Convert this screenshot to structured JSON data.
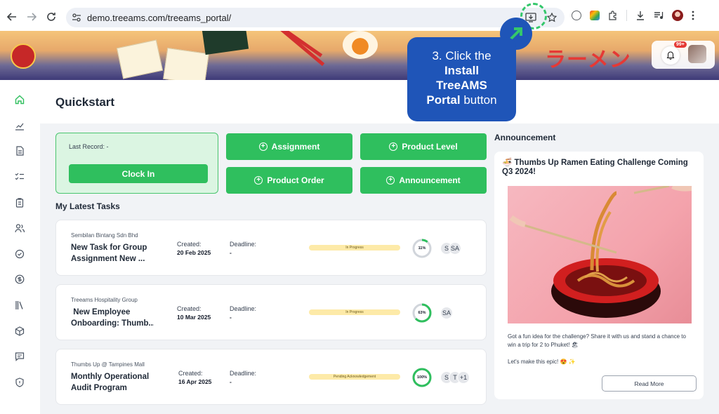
{
  "browser": {
    "url": "demo.treeams.com/treeams_portal/"
  },
  "banner": {
    "ramen_text": "ラーメン",
    "notification_count": "99+"
  },
  "page": {
    "title": "Quickstart"
  },
  "record": {
    "label": "Last Record: -",
    "clock_in_label": "Clock In"
  },
  "quick_actions": [
    {
      "label": "Assignment"
    },
    {
      "label": "Product Level"
    },
    {
      "label": "Product Order"
    },
    {
      "label": "Announcement"
    }
  ],
  "tasks_section": {
    "title": "My Latest Tasks",
    "created_label": "Created:",
    "deadline_label": "Deadline:"
  },
  "tasks": [
    {
      "company": "Sembilan Bintang Sdn Bhd",
      "title": "New Task for Group\nAssignment New ...",
      "created": "20 Feb 2025",
      "deadline": "-",
      "status": "In Progress",
      "progress_text": "11%",
      "progress": 0.11,
      "assignees": [
        "S",
        "SA"
      ]
    },
    {
      "company": "Treeams Hospitality Group",
      "title": " New Employee\nOnboarding: Thumb...",
      "created": "10 Mar 2025",
      "deadline": "-",
      "status": "In Progress",
      "progress_text": "63%",
      "progress": 0.63,
      "assignees": [
        "SA"
      ]
    },
    {
      "company": "Thumbs Up @ Tampines Mall",
      "title": "Monthly Operational\nAudit Program",
      "created": "16 Apr 2025",
      "deadline": "-",
      "status": "Pending Acknowledgement",
      "progress_text": "100%",
      "progress": 1.0,
      "assignees": [
        "S",
        "T",
        "+1"
      ]
    }
  ],
  "announcement": {
    "section_title": "Announcement",
    "headline": "🍜 Thumbs Up Ramen Eating Challenge Coming Q3 2024!",
    "body": "Got a fun idea for the challenge? Share it with us and stand a chance to win a trip for 2 to Phuket! 🏖",
    "body2": "Let's make this epic! 😍 ✨",
    "read_more_label": "Read More"
  },
  "callout": {
    "line1": "3. Click the",
    "line2": "Install",
    "line3": "TreeAMS",
    "line4": "Portal",
    "line4_suffix": " button"
  },
  "colors": {
    "primary_green": "#2fbf5e",
    "callout_blue": "#1f55b8",
    "status_yellow": "#fdeaa8"
  }
}
